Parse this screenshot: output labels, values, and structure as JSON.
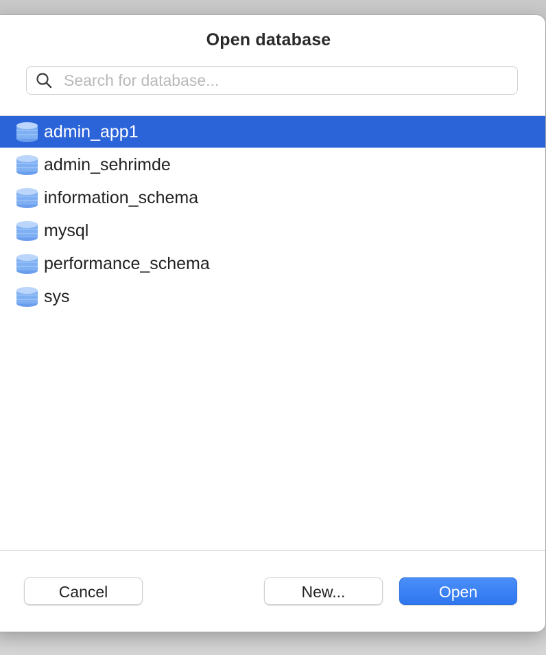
{
  "dialog": {
    "title": "Open database"
  },
  "search": {
    "placeholder": "Search for database...",
    "value": "",
    "icon": "search-icon"
  },
  "databases": [
    {
      "name": "admin_app1",
      "selected": true,
      "icon": "database-icon"
    },
    {
      "name": "admin_sehrimde",
      "selected": false,
      "icon": "database-icon"
    },
    {
      "name": "information_schema",
      "selected": false,
      "icon": "database-icon"
    },
    {
      "name": "mysql",
      "selected": false,
      "icon": "database-icon"
    },
    {
      "name": "performance_schema",
      "selected": false,
      "icon": "database-icon"
    },
    {
      "name": "sys",
      "selected": false,
      "icon": "database-icon"
    }
  ],
  "buttons": {
    "cancel": "Cancel",
    "new": "New...",
    "open": "Open"
  },
  "colors": {
    "selection": "#2b63d9",
    "primary_button": "#3a7ff3",
    "db_icon": "#7aaaf0"
  }
}
